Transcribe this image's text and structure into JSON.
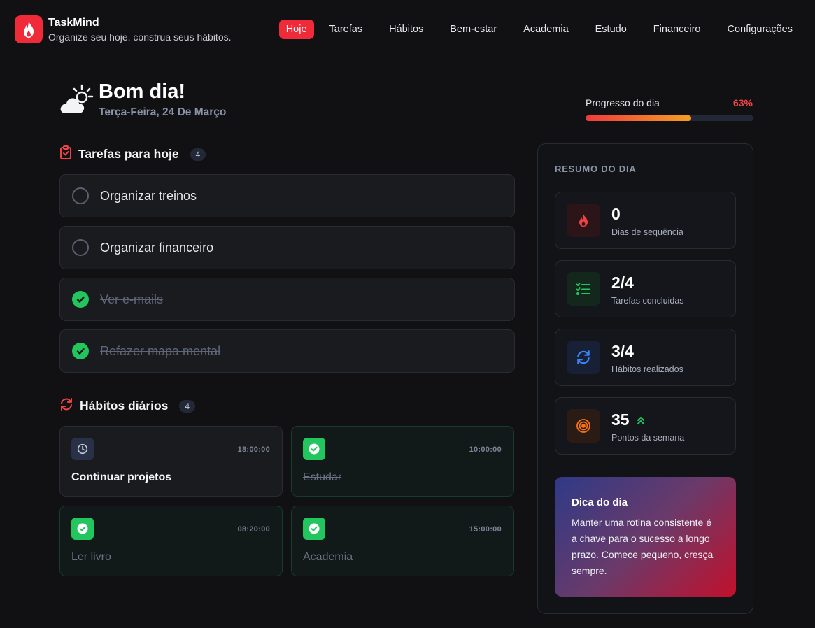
{
  "app": {
    "name": "TaskMind",
    "tagline": "Organize seu hoje, construa seus hábitos.",
    "accent": "#ef2b3a"
  },
  "nav": {
    "items": [
      {
        "label": "Hoje",
        "active": true
      },
      {
        "label": "Tarefas"
      },
      {
        "label": "Hábitos"
      },
      {
        "label": "Bem-estar"
      },
      {
        "label": "Academia"
      },
      {
        "label": "Estudo"
      },
      {
        "label": "Financeiro"
      },
      {
        "label": "Configurações"
      }
    ]
  },
  "greeting": {
    "title": "Bom dia!",
    "date": "Terça-Feira, 24 De Março",
    "icon": "sun-cloud-icon"
  },
  "progress": {
    "label": "Progresso do dia",
    "percent_text": "63%",
    "value": 0.63
  },
  "tasks": {
    "title": "Tarefas para hoje",
    "count": "4",
    "items": [
      {
        "label": "Organizar treinos",
        "done": false
      },
      {
        "label": "Organizar financeiro",
        "done": false
      },
      {
        "label": "Ver e-mails",
        "done": true
      },
      {
        "label": "Refazer mapa mental",
        "done": true
      }
    ]
  },
  "habits": {
    "title": "Hábitos diários",
    "count": "4",
    "items": [
      {
        "name": "Continuar projetos",
        "time": "18:00:00",
        "done": false
      },
      {
        "name": "Estudar",
        "time": "10:00:00",
        "done": true
      },
      {
        "name": "Ler livro",
        "time": "08:20:00",
        "done": true
      },
      {
        "name": "Academia",
        "time": "15:00:00",
        "done": true
      }
    ]
  },
  "summary": {
    "title": "RESUMO DO DIA",
    "stats": [
      {
        "value": "0",
        "label": "Dias de sequência",
        "icon": "flame-icon",
        "color": "#ef4444"
      },
      {
        "value": "2/4",
        "label": "Tarefas concluidas",
        "icon": "checklist-icon",
        "color": "#22c55e"
      },
      {
        "value": "3/4",
        "label": "Hábitos realizados",
        "icon": "refresh-icon",
        "color": "#3b82f6"
      },
      {
        "value": "35",
        "label": "Pontos da semana",
        "icon": "target-icon",
        "color": "#f97316"
      }
    ],
    "tip": {
      "title": "Dica do dia",
      "text": "Manter uma rotina consistente é a chave para o sucesso a longo prazo. Comece pequeno, cresça sempre."
    }
  }
}
